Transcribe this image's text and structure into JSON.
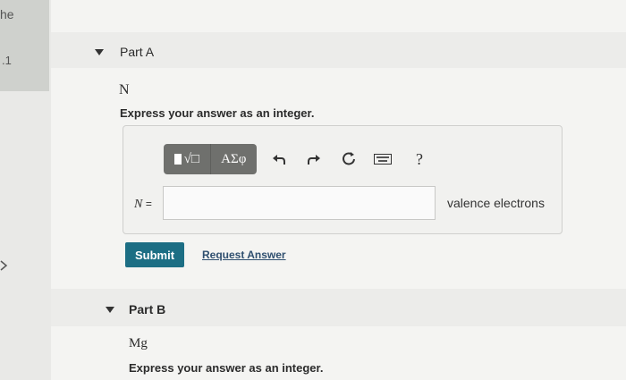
{
  "sidebar": {
    "text_top": "he",
    "text_mid": ".1"
  },
  "partA": {
    "label": "Part A",
    "variable": "N",
    "instruction": "Express your answer as an integer.",
    "toolbar": {
      "templates_label": "√□",
      "greek_label": "ΑΣφ",
      "help_label": "?"
    },
    "equation_var": "N",
    "equation_sign": "=",
    "input_value": "",
    "units": "valence electrons",
    "submit_label": "Submit",
    "request_label": "Request Answer"
  },
  "partB": {
    "label": "Part B",
    "variable": "Mg",
    "instruction": "Express your answer as an integer."
  },
  "colors": {
    "submit_bg": "#1c6e84",
    "toolbar_bg": "#6f706d",
    "link": "#2f4f6f"
  }
}
